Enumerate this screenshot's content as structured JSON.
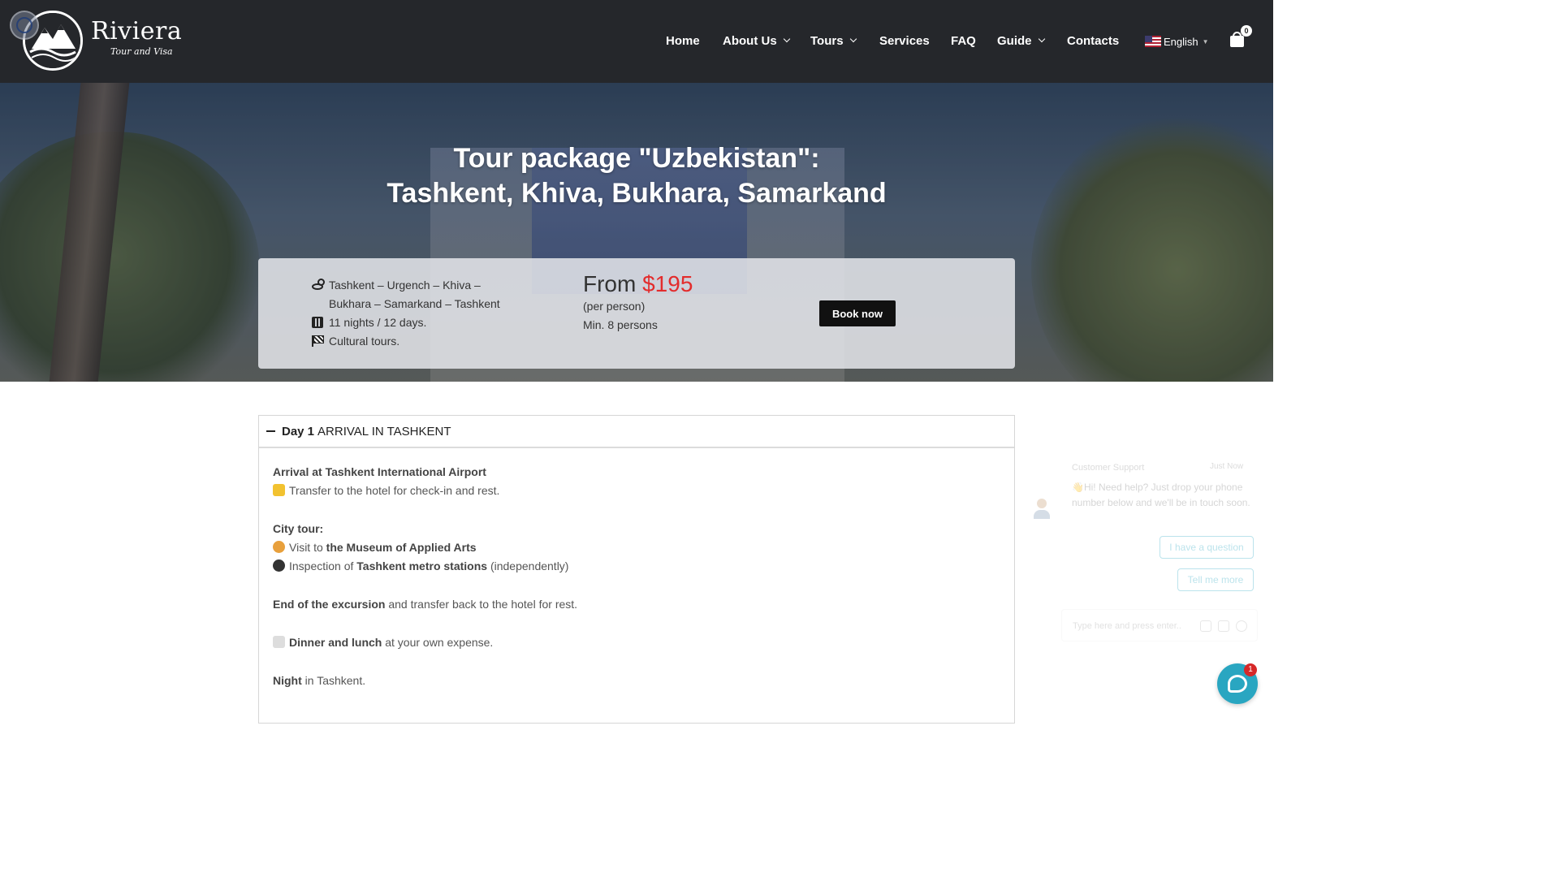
{
  "header": {
    "logo_name": "Riviera",
    "logo_tagline": "Tour and Visa",
    "nav": [
      {
        "label": "Home"
      },
      {
        "label": "About Us",
        "dropdown": true
      },
      {
        "label": "Tours",
        "dropdown": true
      },
      {
        "label": "Services"
      },
      {
        "label": "FAQ"
      },
      {
        "label": "Guide",
        "dropdown": true
      },
      {
        "label": "Contacts"
      }
    ],
    "language": "English",
    "cart_count": "0"
  },
  "hero": {
    "title_line1": "Tour package \"Uzbekistan\":",
    "title_line2": "Tashkent, Khiva, Bukhara, Samarkand"
  },
  "tour_info": {
    "route_line1": "Tashkent – Urgench – Khiva –",
    "route_line2": "Bukhara – Samarkand – Tashkent",
    "duration": "11 nights / 12 days.",
    "type": "Cultural tours.",
    "price_prefix": "From",
    "price_amount": "$195",
    "price_note": "(per person)",
    "min_persons": "Min. 8 persons",
    "book_label": "Book now"
  },
  "itinerary": {
    "day_label": "Day 1",
    "day_title": "ARRIVAL IN TASHKENT",
    "arrival": "Arrival at Tashkent International Airport",
    "transfer": "Transfer to the hotel for check-in and rest.",
    "city_tour_heading": "City tour:",
    "visit_prefix": "Visit to",
    "visit_place": "the Museum of Applied Arts",
    "inspect_prefix": "Inspection of",
    "inspect_place": "Tashkent metro stations",
    "inspect_suffix": "(independently)",
    "end_bold": "End of the excursion",
    "end_rest": "and transfer back to the hotel for rest.",
    "meals_bold": "Dinner and lunch",
    "meals_rest": "at your own expense.",
    "night_bold": "Night",
    "night_rest": "in Tashkent."
  },
  "chat": {
    "agent_name": "Customer Support",
    "time": "Just Now",
    "message": "👋Hi! Need help? Just drop your phone number below and we'll be in touch soon.",
    "quick_reply_1": "I have a question",
    "quick_reply_2": "Tell me more",
    "input_placeholder": "Type here and press enter..",
    "unread_count": "1"
  },
  "colors": {
    "header_bg": "#25272b",
    "price_accent": "#e32c2c",
    "chat_accent": "#29a6c1"
  }
}
